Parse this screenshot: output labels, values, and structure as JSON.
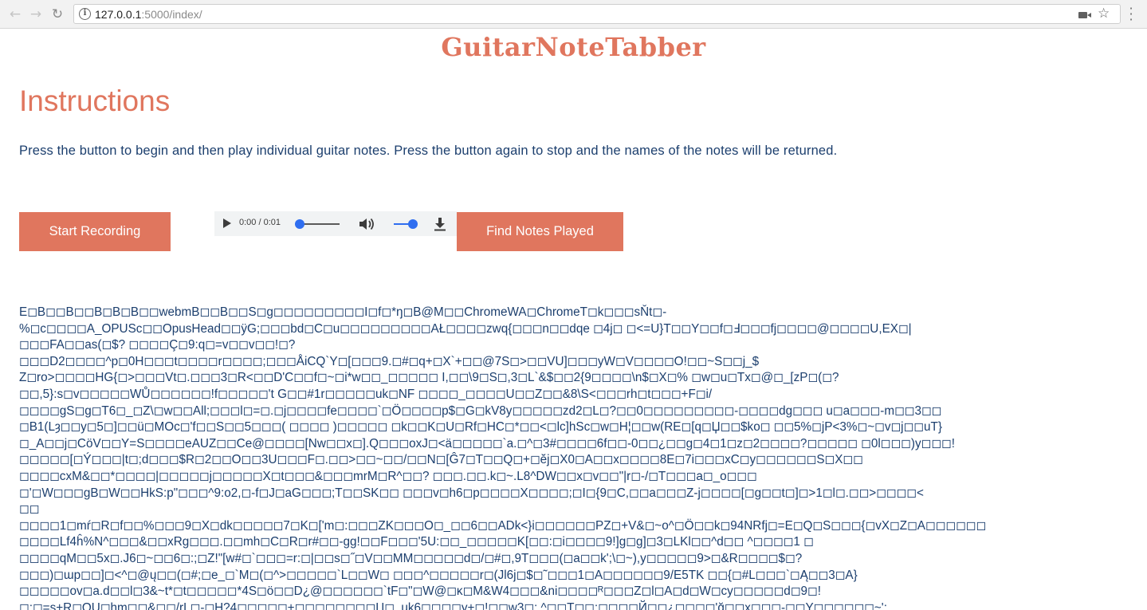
{
  "browser": {
    "url_host": "127.0.0.1",
    "url_path": ":5000/index/"
  },
  "page": {
    "logo": "GuitarNoteTabber",
    "instructions_title": "Instructions",
    "instructions_text": "Press the button to begin and then play individual guitar notes. Press the button again to stop and the names of the notes will be returned.",
    "start_button": "Start Recording",
    "find_button": "Find Notes Played"
  },
  "audio": {
    "time": "0:00 / 0:01",
    "progress": 0.0,
    "volume": 1.0
  },
  "output": {
    "lines": [
      "E◻B◻◻B◻◻B◻B◻B◻◻webmB◻◻B◻◻S◻g◻◻◻◻◻◻◻◻◻I◻f◻*ŋ◻B@M◻◻ChromeWA◻ChromeT◻k◻◻◻sŇt◻-",
      "%◻c◻◻◻◻A_OPUSc◻◻OpusHead◻◻ÿG;◻◻◻bd◻C◻u◻◻◻◻◻◻◻◻◻AŁ◻◻◻◻zwq{◻◻◻n◻◻dqe ◻4j◻ ◻<=U}T◻◻Y◻◻f◻Ⅎ◻◻◻fj◻◻◻◻@◻◻◻◻U,EX◻|",
      "◻◻◻FA◻◻as(◻$? ◻◻◻◻Ç◻9:q◻=v◻◻v◻◻!◻?",
      "◻◻◻D2◻◻◻◻^p◻0H◻◻◻t◻◻◻◻r◻◻◻◻;◻◻◻ÅiCQ`Y◻[◻◻◻9.◻#◻q+◻X`+◻◻@7S◻>◻◻VU]◻◻◻yW◻V◻◻◻◻O!◻◻~S◻◻j_$",
      "Z◻ro>◻◻◻◻HG{◻>◻◻◻Vt◻.◻◻◻3◻R<◻◻D'C◻◻f◻~◻i*w◻◻_◻◻◻◻◻ I,◻◻\\9◻S◻,3◻L`&$◻◻2{9◻◻◻◻\\n$◻X◻% ◻w◻u◻Tx◻@◻_[zP◻(◻?",
      "◻◻,5}:s◻v◻◻◻◻◻WŮ◻◻◻◻◻◻!f◻◻◻◻◻'t G◻◻#1r◻◻◻◻◻uk◻NF ◻◻◻◻_◻◻◻◻U◻◻Z◻◻&8\\S<◻◻◻rh◻t◻◻◻+F◻i/",
      "◻◻◻◻gS◻g◻T6◻_◻Z\\◻w◻◻All;◻◻◻l◻=◻.◻j◻◻◻◻fe◻◻◻◻`◻Ö◻◻◻◻p$◻G◻kV8y◻◻◻◻◻zd2◻L◻?◻◻0◻◻◻◻◻◻◻◻◻-◻◻◻◻dg◻◻◻ u◻a◻◻◻-m◻◻3◻◻",
      "◻B1(Lȝ◻◻y◻5◻]◻◻ü◻MOc◻'f◻◻S◻◻5◻◻◻( ◻◻◻◻ )◻◻◻◻◻ ◻k◻◻K◻U◻Rf◻HC◻*◻◻<◻lc]hSc◻w◻H¦◻◻w(RE◻[q◻Џ◻◻$ko◻ ◻◻5%◻jP<3%◻~◻v◻j◻◻uT}",
      "◻_A◻◻j◻CöV◻◻Y=S◻◻◻◻eAUZ◻◻Ce@◻◻◻◻[Nw◻◻x◻].Q◻◻◻oxJ◻<ä◻◻◻◻◻`a.◻^◻3#◻◻◻◻6f◻◻-0◻◻¿◻◻g◻4◻1◻z◻2◻◻◻◻?◻◻◻◻◻ ◻0l◻◻◻)y◻◻◻!",
      "◻◻◻◻◻[◻Ý◻◻◻|t◻;d◻◻◻$R◻2◻◻O◻◻3U◻◻◻F◻.◻◻>◻◻~◻◻/◻◻N◻[Ĝ7◻T◻◻Q◻+◻ӗj◻X0◻A◻◻x◻◻◻◻8E◻7i◻◻◻xC◻y◻◻◻◻◻◻S◻X◻◻",
      "◻◻◻◻cxM&◻◻*◻◻◻◻|◻◻◻◻◻j◻◻◻◻◻X◻t◻◻◻&◻◻◻mrM◻R^◻◻? ◻◻◻.◻◻.k◻~.L8^DW◻◻x◻v◻◻\"|r◻-/◻T◻◻◻a◻_o◻◻◻",
      "◻'◻W◻◻◻gB◻W◻◻HkS:p\"◻◻◻^9:o2,◻-f◻J◻aG◻◻◻;T◻◻SK◻◻ ◻◻◻v◻h6◻p◻◻◻◻X◻◻◻◻;◻I◻{9◻C,◻◻a◻◻◻Z-j◻◻◻◻[◻g◻◻t◻]◻>1◻l◻.◻◻>◻◻◻◻<",
      "◻◻",
      "◻◻◻◻1◻mŕ◻R◻f◻◻%◻◻◻9◻X◻dk◻◻◻◻◻7◻K◻['m◻:◻◻◻ZK◻◻◻O◻_◻◻6◻◻ADk<}i◻◻◻◻◻◻PZ◻+V&◻~o^◻Ӧ◻◻k◻94NRfj◻=E◻Q◻S◻◻◻{◻vX◻Z◻A◻◻◻◻◻◻",
      "◻◻◻◻Lf4ĥ%N^◻◻◻&◻◻xRg◻◻◻.◻◻mh◻C◻R◻r#◻◻-gg!◻◻F◻◻◻'5U:◻◻_◻◻◻◻◻K[◻◻:◻i◻◻◻◻9!]g◻g]◻3◻LKl◻◻^d◻◻ ^◻◻◻◻1 ◻",
      "◻◻◻◻qM◻◻5x◻.J6◻~◻◻6◻:;◻Z!\"[w#◻`◻◻◻=r:◻|◻◻s◻˝◻V◻◻MM◻◻◻◻◻d◻/◻#◻,9T◻◻◻(◻a◻◻k';\\◻~),y◻◻◻◻◻9>◻&R◻◻◻◻$◻?",
      "◻◻◻)◻ɯp◻◻]◻<^◻@ų◻◻(◻#;◻e_◻`M◻(◻^>◻◻◻◻◻`L◻◻W◻ ◻◻◻^◻◻◻◻◻r◻(Jl6j◻$◻˜◻◻◻1◻A◻◻◻◻◻◻9/E5TK ◻◻{◻#L◻◻◻`◻Ą◻◻3◻A}",
      "◻◻◻◻◻ov◻a.d◻◻l◻3&~t*◻t◻◻◻◻◻*4S◻ö◻◻D¿@◻◻◻◻◻◻`tF◻\"◻W@◻κ◻M&W4◻◻◻&ni◻◻◻◻ᴿ◻◻◻Z◻l◻A◻d◻W◻cy◻◻◻◻◻d◻9◻!",
      "◻;◻=s+R◻QU◻hɱ◻◻&◻◻/rL◻-◻H?4◻◻◻◻◻+◻◻◻◻◻◻◻◻Џ◻_uk6◻◻◻◻y+◻!◻◻w3◻; ^◻◻T◻◻;◻◻◻◻Й◻◻¿◻◻◻◻'ğ◻◻x◻◻◻-◻◻Y◻◻◻◻◻◻~';"
    ]
  }
}
